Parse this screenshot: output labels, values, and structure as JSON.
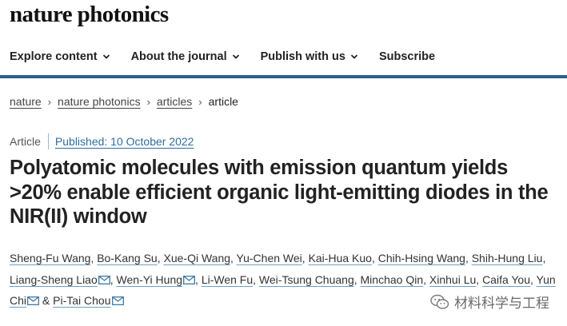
{
  "site": {
    "brand": "nature photonics"
  },
  "nav": {
    "items": [
      {
        "label": "Explore content",
        "has_dropdown": true
      },
      {
        "label": "About the journal",
        "has_dropdown": true
      },
      {
        "label": "Publish with us",
        "has_dropdown": true
      },
      {
        "label": "Subscribe",
        "has_dropdown": false
      }
    ]
  },
  "breadcrumb": {
    "items": [
      "nature",
      "nature photonics",
      "articles",
      "article"
    ]
  },
  "article": {
    "type": "Article",
    "published": "Published: 10 October 2022",
    "title": "Polyatomic molecules with emission quantum yields >20% enable efficient organic light-emitting diodes in the NIR(II) window",
    "authors": [
      "Sheng-Fu Wang",
      "Bo-Kang Su",
      "Xue-Qi Wang",
      "Yu-Chen Wei",
      "Kai-Hua Kuo",
      "Chih-Hsing Wang",
      "Shih-Hung Liu",
      "Liang-Sheng Liao",
      "Wen-Yi Hung",
      "Li-Wen Fu",
      "Wei-Tsung Chuang",
      "Minchao Qin",
      "Xinhui Lu",
      "Caifa You",
      "Yun Chi",
      "Pi-Tai Chou"
    ],
    "and_text": "&"
  },
  "watermark": {
    "text": "材料科学与工程",
    "icon": "wechat-icon"
  },
  "colors": {
    "accent_bar": "#29608f",
    "link": "#2e6e9e"
  }
}
